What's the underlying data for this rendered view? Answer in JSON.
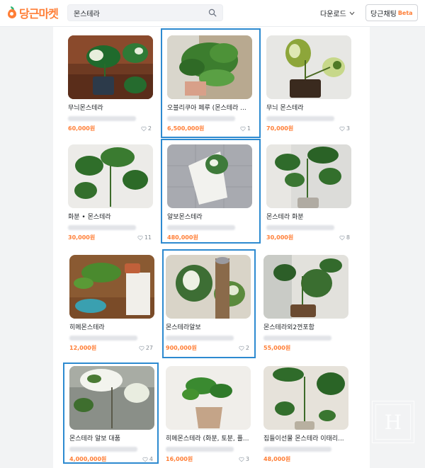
{
  "header": {
    "logo_text": "당근마켓",
    "search_value": "몬스테라",
    "download_label": "다운로드",
    "chat_label": "당근채팅",
    "chat_badge": "Beta"
  },
  "products": [
    {
      "title": "무늬몬스테라",
      "price": "60,000원",
      "likes": "2"
    },
    {
      "title": "오블리쿠아 페루 (몬스테라 ...",
      "price": "6,500,000원",
      "likes": "1"
    },
    {
      "title": "무늬 몬스테라",
      "price": "70,000원",
      "likes": "3"
    },
    {
      "title": "화분 • 몬스테라",
      "price": "30,000원",
      "likes": "11"
    },
    {
      "title": "알보몬스테라",
      "price": "480,000원",
      "likes": ""
    },
    {
      "title": "몬스테라 화분",
      "price": "30,000원",
      "likes": "8"
    },
    {
      "title": "히메몬스테라",
      "price": "12,000원",
      "likes": "27"
    },
    {
      "title": "몬스테라알보",
      "price": "900,000원",
      "likes": "2"
    },
    {
      "title": "몬스테라외2껀포함",
      "price": "55,000원",
      "likes": ""
    },
    {
      "title": "몬스테라 알보 대품",
      "price": "4,000,000원",
      "likes": "4"
    },
    {
      "title": "히메몬스테라 (화분, 토분, 플...",
      "price": "16,000원",
      "likes": "3"
    },
    {
      "title": "집들이선물 몬스테라 이태리...",
      "price": "48,000원",
      "likes": ""
    }
  ],
  "icons": {
    "search": "search-icon",
    "chevron": "chevron-down-icon",
    "heart": "heart-icon"
  },
  "colors": {
    "brand": "#ff7e36",
    "highlight": "#2d8ad0"
  },
  "watermark": "H"
}
